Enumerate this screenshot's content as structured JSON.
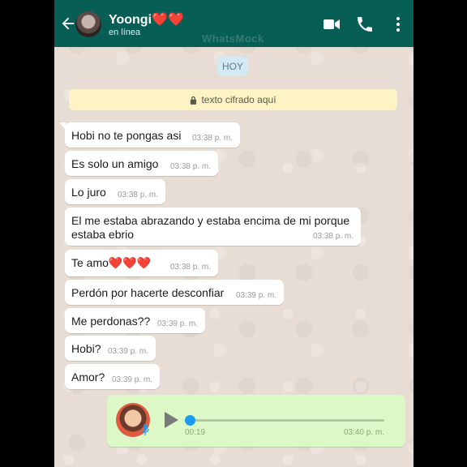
{
  "header": {
    "contact_name": "Yoongi❤️❤️",
    "status": "en línea",
    "watermark": "WhatsMock",
    "icons": [
      "back-arrow-icon",
      "video-call-icon",
      "phone-call-icon",
      "more-options-icon"
    ]
  },
  "chat": {
    "date_chip": "HOY",
    "encryption_notice": "texto cifrado aquí",
    "messages": [
      {
        "text": "Hobi no te pongas asi",
        "time": "03:38 p. m."
      },
      {
        "text": "Es solo un amigo",
        "time": "03:38 p. m."
      },
      {
        "text": "Lo juro",
        "time": "03:38 p. m."
      },
      {
        "text": "El me estaba abrazando y estaba encima de mi porque estaba ebrio",
        "time": "03:38 p. m."
      },
      {
        "text": "Te amo❤️❤️❤️",
        "time": "03:38 p. m."
      },
      {
        "text": "Perdón por hacerte desconfiar",
        "time": "03:39 p. m."
      },
      {
        "text": "Me perdonas??",
        "time": "03:39 p. m."
      },
      {
        "text": "Hobi?",
        "time": "03:39 p. m."
      },
      {
        "text": "Amor?",
        "time": "03:39 p. m."
      }
    ],
    "voice_note": {
      "duration": "00:19",
      "time": "03:40 p. m.",
      "progress": 0.0
    }
  },
  "colors": {
    "header": "#075e54",
    "chat_background": "#e7ddd4",
    "outgoing_bubble": "#dcf8c6",
    "incoming_bubble": "#ffffff",
    "encryption_banner": "#fdf3c4",
    "date_chip": "#d3e9f4"
  }
}
